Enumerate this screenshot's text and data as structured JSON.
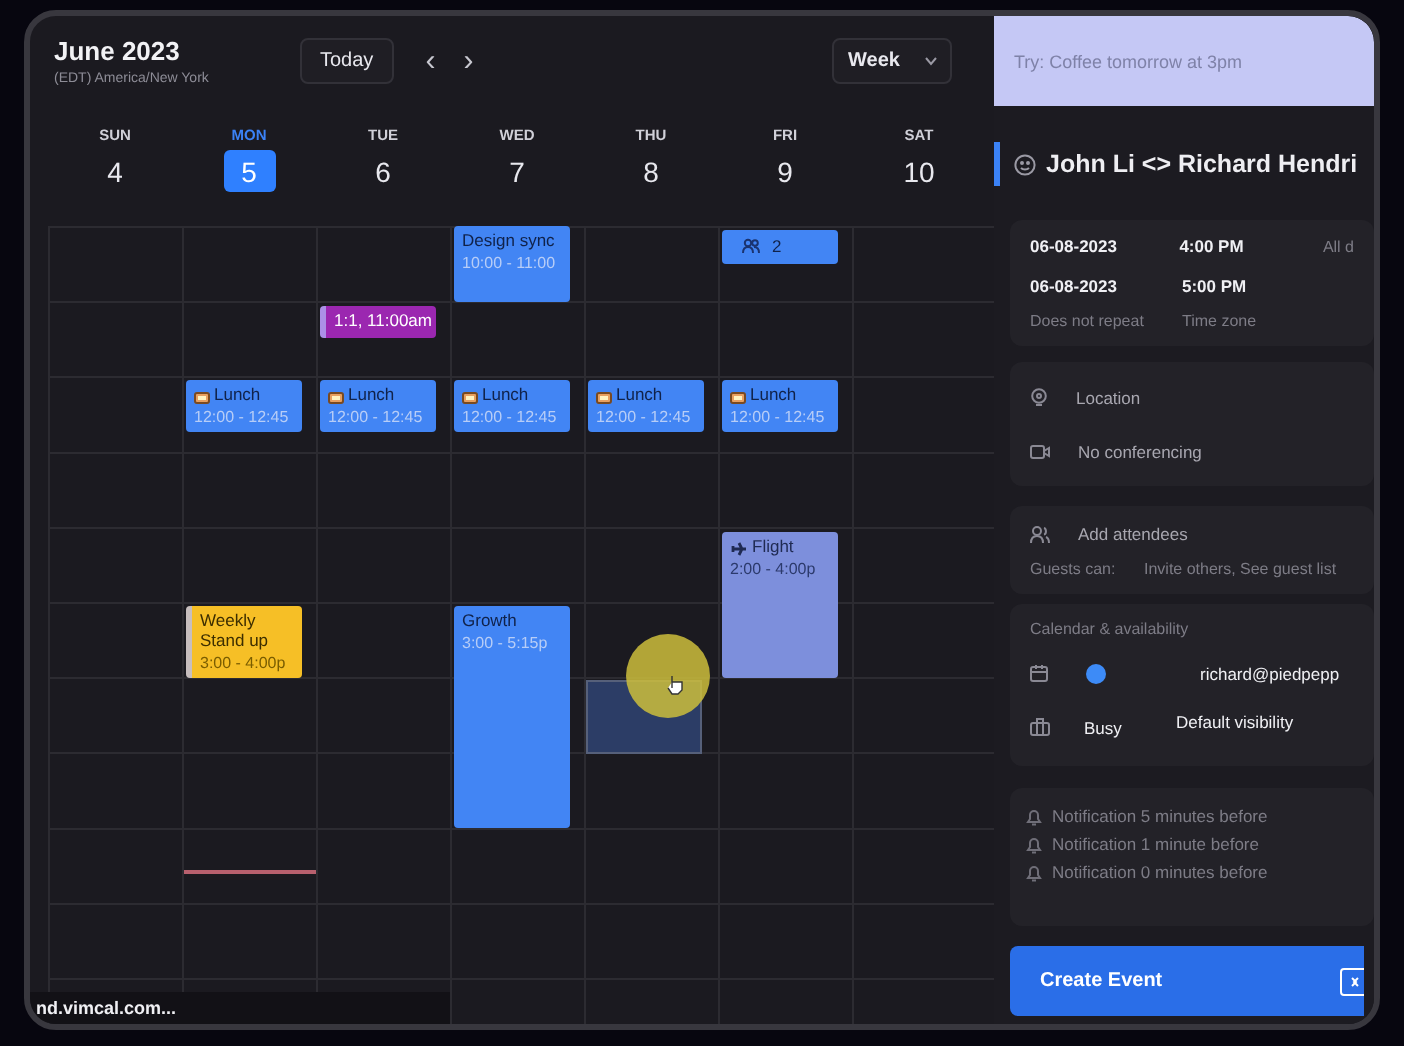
{
  "calendar": {
    "month_title": "June 2023",
    "time_zone": "(EDT) America/New York",
    "today_button": "Today",
    "prev_icon": "‹",
    "next_icon": "›",
    "view_select": {
      "value": "Week"
    },
    "days": [
      {
        "name": "SUN",
        "number": "4",
        "selected": false
      },
      {
        "name": "MON",
        "number": "5",
        "selected": true
      },
      {
        "name": "TUE",
        "number": "6",
        "selected": false
      },
      {
        "name": "WED",
        "number": "7",
        "selected": false
      },
      {
        "name": "THU",
        "number": "8",
        "selected": false
      },
      {
        "name": "FRI",
        "number": "9",
        "selected": false
      },
      {
        "name": "SAT",
        "number": "10",
        "selected": false
      }
    ],
    "events": [
      {
        "kind": "plain",
        "title": "Design sync",
        "time": "10:00 - 11:00",
        "color": "#4285f4"
      },
      {
        "kind": "group",
        "title": "2",
        "color": "#4285f4"
      },
      {
        "kind": "compact",
        "title": "1:1, 11:00am",
        "color": "#9b27b0"
      },
      {
        "kind": "lunch",
        "title": "Lunch",
        "time": "12:00 - 12:45",
        "color": "#4285f4"
      },
      {
        "kind": "lunch",
        "title": "Lunch",
        "time": "12:00 - 12:45",
        "color": "#4285f4"
      },
      {
        "kind": "lunch",
        "title": "Lunch",
        "time": "12:00 - 12:45",
        "color": "#4285f4"
      },
      {
        "kind": "lunch",
        "title": "Lunch",
        "time": "12:00 - 12:45",
        "color": "#4285f4"
      },
      {
        "kind": "lunch",
        "title": "Lunch",
        "time": "12:00 - 12:45",
        "color": "#4285f4"
      },
      {
        "kind": "flight",
        "title": "Flight",
        "time": "2:00 - 4:00p",
        "color": "#7d8fdc"
      },
      {
        "kind": "plain",
        "title": "Weekly Stand up",
        "time": "3:00 - 4:00p",
        "color": "#f6bf26"
      },
      {
        "kind": "plain",
        "title": "Growth",
        "time": "3:00 - 5:15p",
        "color": "#4285f4"
      }
    ],
    "link_preview": "nd.vimcal.com..."
  },
  "event_form": {
    "quick_add": {
      "placeholder": "Try: Coffee tomorrow at 3pm"
    },
    "title": "John Li <> Richard Hendri",
    "start_date": "06-08-2023",
    "start_time": "4:00 PM",
    "all_day_label": "All d",
    "end_date": "06-08-2023",
    "end_time": "5:00 PM",
    "repeat": "Does not repeat",
    "time_zone": "Time zone",
    "location": {
      "placeholder": "Location"
    },
    "conferencing": "No conferencing",
    "attendees": {
      "placeholder": "Add attendees"
    },
    "guests_label": "Guests can:",
    "guest_permissions": "Invite others, See guest list",
    "calendar_heading": "Calendar & availability",
    "calendar_account": "richard@piedpepp",
    "availability": "Busy",
    "visibility": "Default visibility",
    "notifications": [
      "Notification 5 minutes before",
      "Notification 1 minute before",
      "Notification 0 minutes before"
    ],
    "create_button": "Create Event"
  }
}
